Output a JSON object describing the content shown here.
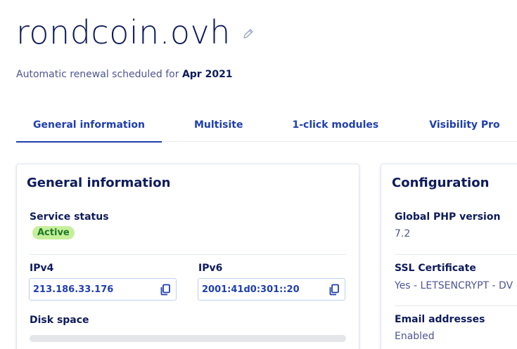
{
  "header": {
    "domain": "rondcoin.ovh",
    "renewal_prefix": "Automatic renewal scheduled for ",
    "renewal_date": "Apr 2021"
  },
  "tabs": [
    {
      "label": "General information",
      "active": true
    },
    {
      "label": "Multisite",
      "active": false
    },
    {
      "label": "1-click modules",
      "active": false
    },
    {
      "label": "Visibility Pro",
      "active": false
    }
  ],
  "general": {
    "title": "General information",
    "service_status_label": "Service status",
    "service_status_value": "Active",
    "ipv4_label": "IPv4",
    "ipv4_value": "213.186.33.176",
    "ipv6_label": "IPv6",
    "ipv6_value": "2001:41d0:301::20",
    "disk_label": "Disk space"
  },
  "configuration": {
    "title": "Configuration",
    "php_label": "Global PHP version",
    "php_value": "7.2",
    "ssl_label": "SSL Certificate",
    "ssl_value": "Yes - LETSENCRYPT - DV",
    "email_label": "Email addresses",
    "email_value": "Enabled"
  },
  "colors": {
    "title": "#0e1b5d",
    "link": "#1f3fad",
    "status_bg": "#c6ef9b",
    "status_text": "#1c7a26"
  },
  "icons": {
    "edit": "pencil-icon",
    "copy": "copy-icon"
  }
}
